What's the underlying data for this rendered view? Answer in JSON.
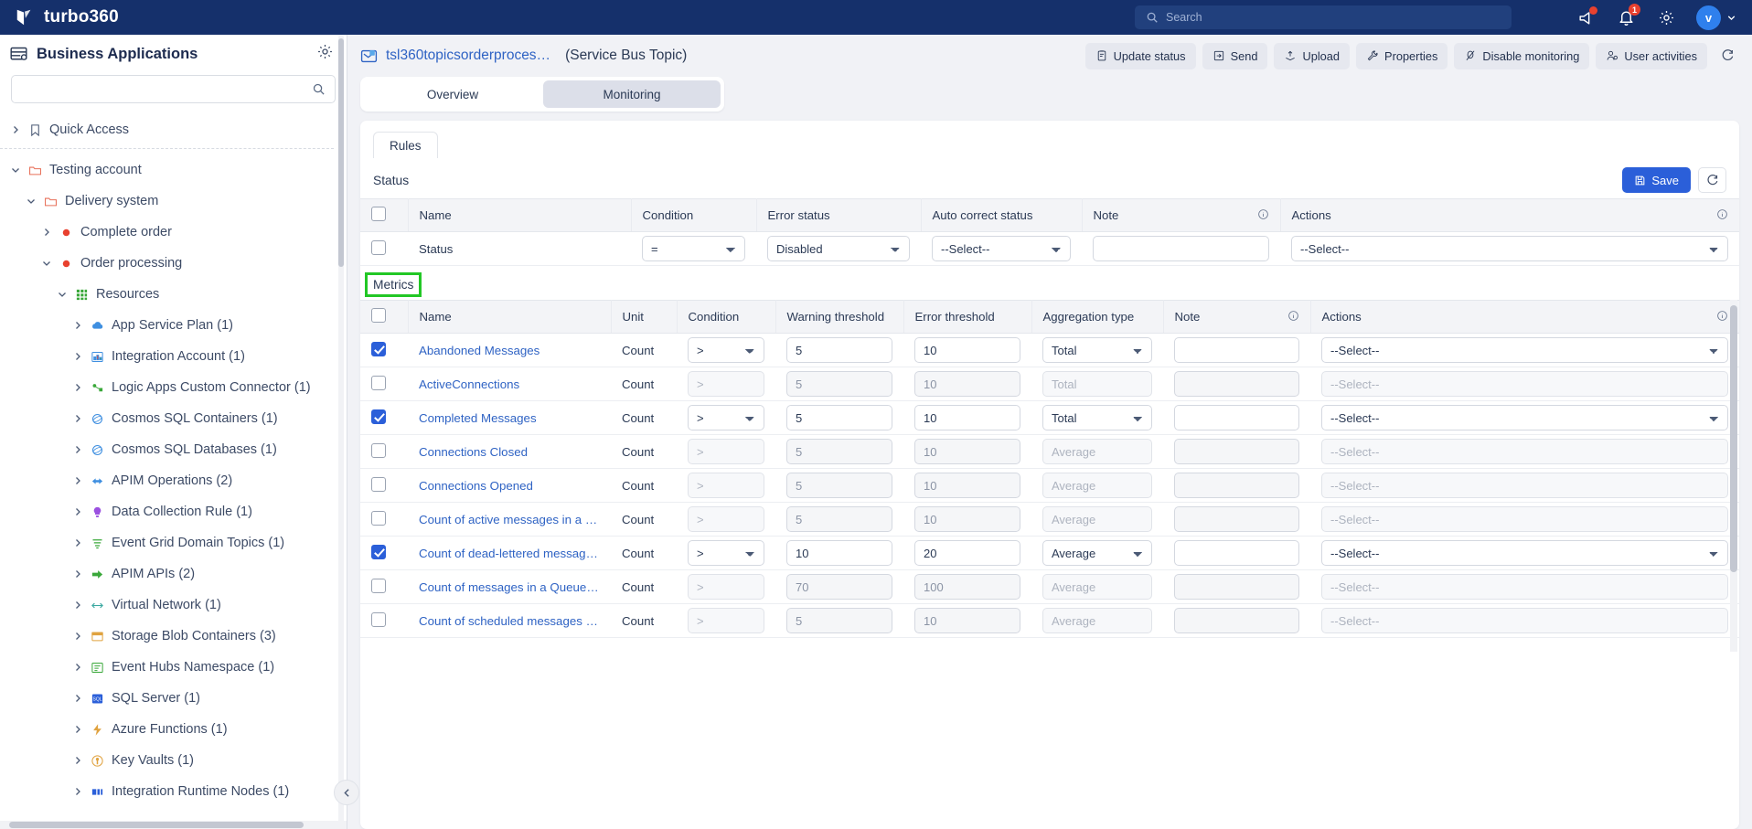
{
  "topbar": {
    "brand": "turbo360",
    "search_placeholder": "Search",
    "icons": [
      {
        "name": "announcement-icon",
        "badge": ""
      },
      {
        "name": "bell-icon",
        "badge": "1"
      },
      {
        "name": "gear-icon",
        "badge": ""
      }
    ],
    "avatar_initial": "v"
  },
  "sidebar": {
    "title": "Business Applications",
    "gear": "gear-icon",
    "search_value": "",
    "search_placeholder": "",
    "tree": [
      {
        "label": "Quick Access",
        "indent": 0,
        "chev": "right",
        "icon": "bookmark",
        "color": "#4b5a75"
      },
      {
        "label": "Testing account",
        "indent": 0,
        "chev": "down",
        "icon": "folder",
        "color": "#e8705a"
      },
      {
        "label": "Delivery system",
        "indent": 1,
        "chev": "down",
        "icon": "folder",
        "color": "#e8705a"
      },
      {
        "label": "Complete order",
        "indent": 2,
        "chev": "right",
        "icon": "dot",
        "color": "#e8412f"
      },
      {
        "label": "Order processing",
        "indent": 2,
        "chev": "down",
        "icon": "dot",
        "color": "#e8412f"
      },
      {
        "label": "Resources",
        "indent": 3,
        "chev": "down",
        "icon": "grid",
        "color": "#3aa83a"
      },
      {
        "label": "App Service Plan (1)",
        "indent": 4,
        "chev": "right",
        "icon": "cloud",
        "color": "#3f8fe0"
      },
      {
        "label": "Integration Account (1)",
        "indent": 4,
        "chev": "right",
        "icon": "chart",
        "color": "#3f8fe0"
      },
      {
        "label": "Logic Apps Custom Connector (1)",
        "indent": 4,
        "chev": "right",
        "icon": "connector",
        "color": "#3aa83a"
      },
      {
        "label": "Cosmos SQL Containers (1)",
        "indent": 4,
        "chev": "right",
        "icon": "cosmos",
        "color": "#3f8fe0"
      },
      {
        "label": "Cosmos SQL Databases (1)",
        "indent": 4,
        "chev": "right",
        "icon": "cosmos",
        "color": "#3f8fe0"
      },
      {
        "label": "APIM Operations (2)",
        "indent": 4,
        "chev": "right",
        "icon": "apim",
        "color": "#3f8fe0"
      },
      {
        "label": "Data Collection Rule (1)",
        "indent": 4,
        "chev": "right",
        "icon": "bulb",
        "color": "#9b51e0"
      },
      {
        "label": "Event Grid Domain Topics (1)",
        "indent": 4,
        "chev": "right",
        "icon": "lines",
        "color": "#3aa83a"
      },
      {
        "label": "APIM APIs (2)",
        "indent": 4,
        "chev": "right",
        "icon": "arrow",
        "color": "#3aa83a"
      },
      {
        "label": "Virtual Network (1)",
        "indent": 4,
        "chev": "right",
        "icon": "network",
        "color": "#3aa8a0"
      },
      {
        "label": "Storage Blob Containers (3)",
        "indent": 4,
        "chev": "right",
        "icon": "blob",
        "color": "#e0a23f"
      },
      {
        "label": "Event Hubs Namespace (1)",
        "indent": 4,
        "chev": "right",
        "icon": "hub",
        "color": "#3aa83a"
      },
      {
        "label": "SQL Server (1)",
        "indent": 4,
        "chev": "right",
        "icon": "sql",
        "color": "#2b5fd9"
      },
      {
        "label": "Azure Functions (1)",
        "indent": 4,
        "chev": "right",
        "icon": "func",
        "color": "#e0a23f"
      },
      {
        "label": "Key Vaults (1)",
        "indent": 4,
        "chev": "right",
        "icon": "key",
        "color": "#e0a23f"
      },
      {
        "label": "Integration Runtime Nodes (1)",
        "indent": 4,
        "chev": "right",
        "icon": "runtime",
        "color": "#2b5fd9"
      }
    ]
  },
  "resource": {
    "name": "tsl360topicsorderproces…",
    "type": "(Service Bus Topic)",
    "icon": "service-bus-topic-icon"
  },
  "toolbar": {
    "buttons": [
      {
        "label": "Update status",
        "icon": "clipboard-icon"
      },
      {
        "label": "Send",
        "icon": "send-icon"
      },
      {
        "label": "Upload",
        "icon": "upload-icon"
      },
      {
        "label": "Properties",
        "icon": "wrench-icon"
      },
      {
        "label": "Disable monitoring",
        "icon": "monitor-off-icon"
      },
      {
        "label": "User activities",
        "icon": "user-activity-icon"
      }
    ],
    "refresh_icon": "refresh-icon"
  },
  "tabs": [
    {
      "label": "Overview",
      "active": false
    },
    {
      "label": "Monitoring",
      "active": true
    }
  ],
  "sub_tabs": [
    {
      "label": "Rules",
      "active": true
    }
  ],
  "status_section": {
    "title": "Status",
    "save_label": "Save",
    "save_icon": "save-icon",
    "refresh_icon": "refresh-icon",
    "columns": [
      "",
      "Name",
      "Condition",
      "Error status",
      "Auto correct status",
      "Note",
      "Actions"
    ],
    "info_columns": [
      5,
      6
    ],
    "rows": [
      {
        "checked": false,
        "name": "Status",
        "condition": "=",
        "error_status": "Disabled",
        "auto_correct_status": "--Select--",
        "note": "",
        "action": "--Select--"
      }
    ]
  },
  "metrics_section": {
    "title": "Metrics",
    "highlighted": true,
    "highlight_color": "#22c725",
    "columns": [
      "",
      "Name",
      "Unit",
      "Condition",
      "Warning threshold",
      "Error threshold",
      "Aggregation type",
      "Note",
      "Actions"
    ],
    "info_columns": [
      7,
      8
    ],
    "rows": [
      {
        "checked": true,
        "name": "Abandoned Messages",
        "unit": "Count",
        "condition": ">",
        "warning": "5",
        "error": "10",
        "aggregation": "Total",
        "note": "",
        "action": "--Select--"
      },
      {
        "checked": false,
        "name": "ActiveConnections",
        "unit": "Count",
        "condition": ">",
        "warning": "5",
        "error": "10",
        "aggregation": "Total",
        "note": "",
        "action": "--Select--"
      },
      {
        "checked": true,
        "name": "Completed Messages",
        "unit": "Count",
        "condition": ">",
        "warning": "5",
        "error": "10",
        "aggregation": "Total",
        "note": "",
        "action": "--Select--"
      },
      {
        "checked": false,
        "name": "Connections Closed",
        "unit": "Count",
        "condition": ">",
        "warning": "5",
        "error": "10",
        "aggregation": "Average",
        "note": "",
        "action": "--Select--"
      },
      {
        "checked": false,
        "name": "Connections Opened",
        "unit": "Count",
        "condition": ">",
        "warning": "5",
        "error": "10",
        "aggregation": "Average",
        "note": "",
        "action": "--Select--"
      },
      {
        "checked": false,
        "name": "Count of active messages in a Que…",
        "unit": "Count",
        "condition": ">",
        "warning": "5",
        "error": "10",
        "aggregation": "Average",
        "note": "",
        "action": "--Select--"
      },
      {
        "checked": true,
        "name": "Count of dead-lettered messages i…",
        "unit": "Count",
        "condition": ">",
        "warning": "10",
        "error": "20",
        "aggregation": "Average",
        "note": "",
        "action": "--Select--"
      },
      {
        "checked": false,
        "name": "Count of messages in a Queue/To…",
        "unit": "Count",
        "condition": ">",
        "warning": "70",
        "error": "100",
        "aggregation": "Average",
        "note": "",
        "action": "--Select--"
      },
      {
        "checked": false,
        "name": "Count of scheduled messages in a …",
        "unit": "Count",
        "condition": ">",
        "warning": "5",
        "error": "10",
        "aggregation": "Average",
        "note": "",
        "action": "--Select--"
      }
    ]
  },
  "colors": {
    "brand_navy": "#15306b",
    "accent_blue": "#2b5fd9",
    "link_blue": "#2f63c4",
    "highlight_green": "#22c725",
    "badge_red": "#e8412f"
  }
}
